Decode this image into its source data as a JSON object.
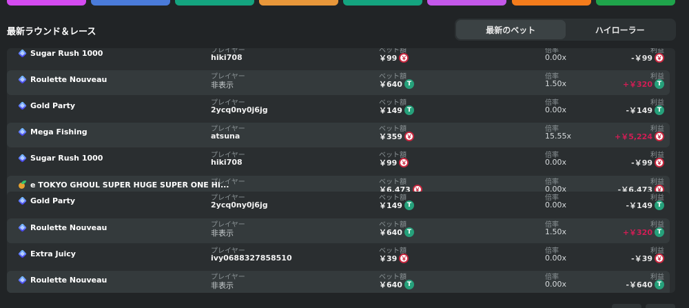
{
  "colors": {
    "top_segments": [
      "#d44bf0",
      "#4a7bd9",
      "#14a47f",
      "#e8973a",
      "#14a47f",
      "#c458ea",
      "#f47c1c",
      "#1fa44b"
    ],
    "yen_coin": "#c9273f",
    "usdt_coin": "#26a17b",
    "profit_positive": "#d21d55"
  },
  "header": {
    "title": "最新ラウンド＆レース",
    "tabs": [
      {
        "label": "最新のベット",
        "active": true
      },
      {
        "label": "ハイローラー",
        "active": false
      }
    ]
  },
  "labels": {
    "player": "プレイヤー",
    "bet": "ベット額",
    "multiplier": "倍率",
    "profit": "利益"
  },
  "rows": [
    {
      "game": "Sugar Rush 1000",
      "icon": "slot-diamond-icon",
      "player": "hiki708",
      "bet": "￥99",
      "bet_coin": "yen",
      "multiplier": "0.00x",
      "profit": "-￥99",
      "profit_coin": "yen",
      "profit_positive": false
    },
    {
      "game": "Roulette Nouveau",
      "icon": "slot-diamond-icon",
      "player": "非表示",
      "bet": "￥640",
      "bet_coin": "usdt",
      "multiplier": "1.50x",
      "profit": "+￥320",
      "profit_coin": "usdt",
      "profit_positive": true
    },
    {
      "game": "Gold Party",
      "icon": "slot-diamond-icon",
      "player": "2ycq0ny0j6jg",
      "bet": "￥149",
      "bet_coin": "usdt",
      "multiplier": "0.00x",
      "profit": "-￥149",
      "profit_coin": "usdt",
      "profit_positive": false
    },
    {
      "game": "Mega Fishing",
      "icon": "slot-diamond-icon",
      "player": "atsuna",
      "bet": "￥359",
      "bet_coin": "yen",
      "multiplier": "15.55x",
      "profit": "+￥5,224",
      "profit_coin": "yen",
      "profit_positive": true
    },
    {
      "game": "Sugar Rush 1000",
      "icon": "slot-diamond-icon",
      "player": "hiki708",
      "bet": "￥99",
      "bet_coin": "yen",
      "multiplier": "0.00x",
      "profit": "-￥99",
      "profit_coin": "yen",
      "profit_positive": false
    },
    {
      "game": "e TOKYO GHOUL SUPER HUGE SUPER ONE HI...",
      "icon": "sports-icon",
      "player": "",
      "bet": "￥6,473",
      "bet_coin": "yen",
      "multiplier": "0.00x",
      "profit": "-￥6,473",
      "profit_coin": "yen",
      "profit_positive": false
    },
    {
      "game": "Gold Party",
      "icon": "slot-diamond-icon",
      "player": "2ycq0ny0j6jg",
      "bet": "￥149",
      "bet_coin": "usdt",
      "multiplier": "0.00x",
      "profit": "-￥149",
      "profit_coin": "usdt",
      "profit_positive": false
    },
    {
      "game": "Roulette Nouveau",
      "icon": "slot-diamond-icon",
      "player": "非表示",
      "bet": "￥640",
      "bet_coin": "usdt",
      "multiplier": "1.50x",
      "profit": "+￥320",
      "profit_coin": "usdt",
      "profit_positive": true
    },
    {
      "game": "Extra Juicy",
      "icon": "slot-diamond-icon",
      "player": "ivy0688327858510",
      "bet": "￥39",
      "bet_coin": "yen",
      "multiplier": "0.00x",
      "profit": "-￥39",
      "profit_coin": "yen",
      "profit_positive": false
    },
    {
      "game": "Roulette Nouveau",
      "icon": "slot-diamond-icon",
      "player": "非表示",
      "bet": "￥640",
      "bet_coin": "usdt",
      "multiplier": "0.00x",
      "profit": "-￥640",
      "profit_coin": "usdt",
      "profit_positive": false
    }
  ]
}
